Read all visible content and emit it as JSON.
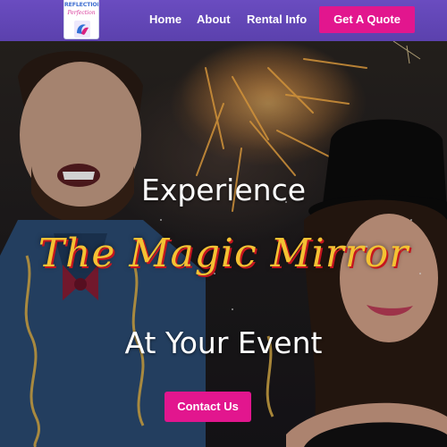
{
  "logo": {
    "line1": "REFLECTION",
    "line2": "Perfection",
    "icon": "mirror-logo-icon"
  },
  "nav": {
    "home": "Home",
    "about": "About",
    "rental_info": "Rental Info",
    "cta": "Get A Quote"
  },
  "hero": {
    "line1": "Experience",
    "line2": "The Magic Mirror",
    "line3": "At Your Event",
    "button": "Contact Us",
    "image": "photo-of-smiling-man-in-bowtie-and-woman-in-top-hat-with-sparklers"
  },
  "colors": {
    "header": "#5b41ad",
    "accent": "#e2168e",
    "headline_gold": "#f4c233",
    "headline_shadow": "#c4161f"
  }
}
